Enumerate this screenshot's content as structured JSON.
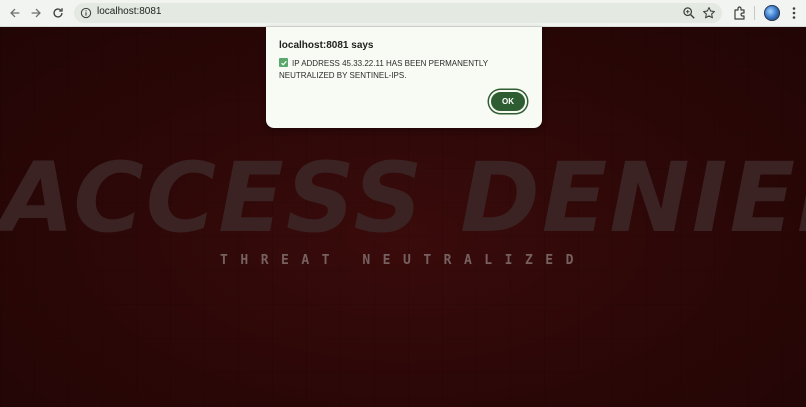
{
  "browser": {
    "url": "localhost:8081",
    "icons": {
      "back": "arrow-left-icon",
      "forward": "arrow-right-icon",
      "reload": "reload-icon",
      "site_info": "info-icon",
      "zoom": "zoom-icon",
      "bookmark": "star-icon",
      "extensions": "puzzle-icon",
      "menu": "kebab-menu-icon"
    }
  },
  "page": {
    "headline": "ACCESS DENIED",
    "subheadline": "THREAT NEUTRALIZED"
  },
  "dialog": {
    "title": "localhost:8081 says",
    "message": "IP ADDRESS 45.33.22.11 HAS BEEN PERMANENTLY NEUTRALIZED BY SENTINEL-IPS.",
    "ok_label": "OK"
  },
  "colors": {
    "page_background": "#2a0707",
    "headline": "#3b2323",
    "subheadline": "#776060",
    "ok_button": "#2f5d32",
    "check_badge": "#5aa86a"
  }
}
